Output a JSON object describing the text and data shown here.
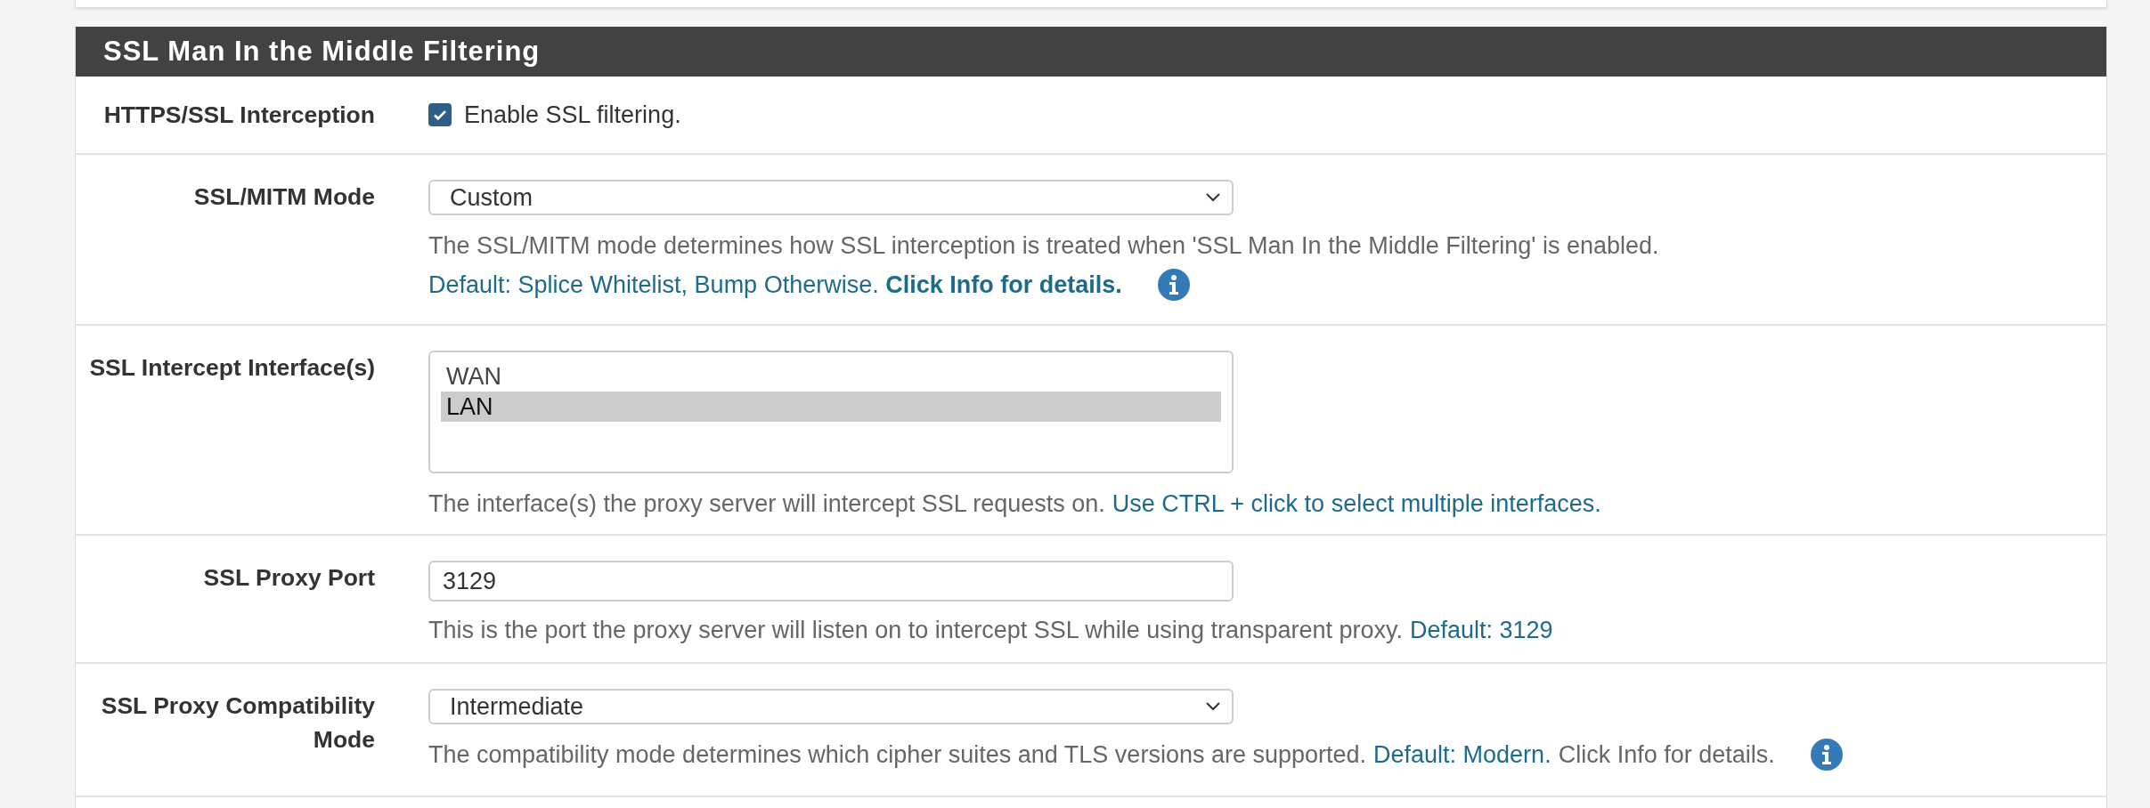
{
  "header": {
    "title": "SSL Man In the Middle Filtering"
  },
  "rows": [
    {
      "kind": "checkbox",
      "label": "HTTPS/SSL Interception",
      "checked": true,
      "text": "Enable SSL filtering."
    },
    {
      "kind": "select",
      "label": "SSL/MITM Mode",
      "value": "Custom",
      "help": [
        {
          "info": false,
          "segments": [
            {
              "kind": "plain",
              "text": "The SSL/MITM mode determines how SSL interception is treated when 'SSL Man In the Middle Filtering' is enabled."
            }
          ]
        },
        {
          "info": true,
          "segments": [
            {
              "kind": "note",
              "text": "Default: Splice Whitelist, Bump Otherwise. **Click Info for details.**"
            }
          ]
        }
      ]
    },
    {
      "kind": "listbox",
      "label": "SSL Intercept Interface(s)",
      "options": [
        {
          "label": "WAN",
          "selected": false
        },
        {
          "label": "LAN",
          "selected": true
        }
      ],
      "help": [
        {
          "info": false,
          "segments": [
            {
              "kind": "plain",
              "text": "The interface(s) the proxy server will intercept SSL requests on."
            },
            {
              "kind": "note",
              "text": "Use CTRL + click to select multiple interfaces."
            }
          ]
        }
      ]
    },
    {
      "kind": "text",
      "label": "SSL Proxy Port",
      "value": "3129",
      "help": [
        {
          "info": false,
          "segments": [
            {
              "kind": "plain",
              "text": "This is the port the proxy server will listen on to intercept SSL while using transparent proxy."
            },
            {
              "kind": "note",
              "text": "Default: 3129"
            }
          ]
        }
      ]
    },
    {
      "kind": "select",
      "label": "SSL Proxy Compatibility Mode",
      "value": "Intermediate",
      "help": [
        {
          "info": true,
          "segments": [
            {
              "kind": "plain",
              "text": "The compatibility mode determines which cipher suites and TLS versions are supported."
            },
            {
              "kind": "note",
              "text": "Default: Modern."
            },
            {
              "kind": "plain",
              "text": "Click Info for details."
            }
          ]
        }
      ]
    }
  ]
}
